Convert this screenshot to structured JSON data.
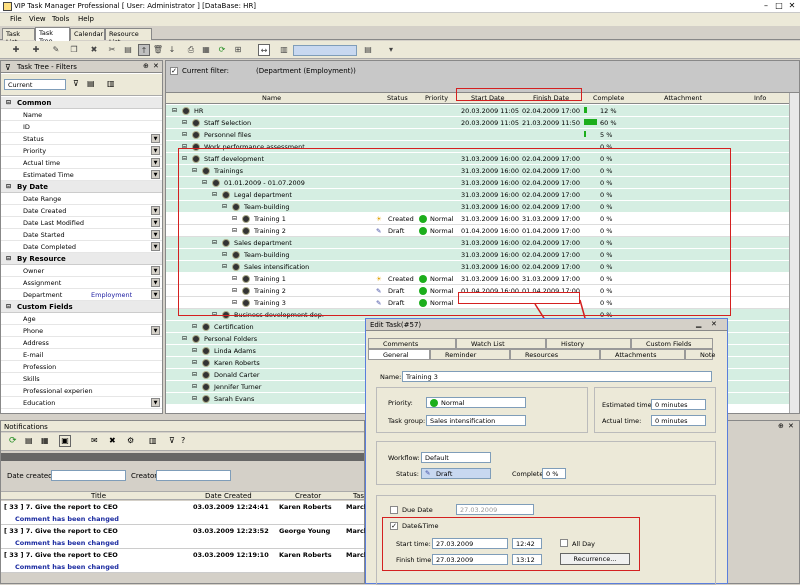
{
  "window": {
    "title": "VIP Task Manager Professional [ User: Administrator ] [DataBase: HR]"
  },
  "menu": [
    "File",
    "View",
    "Tools",
    "Help"
  ],
  "tabs": [
    "Task List",
    "Task Tree",
    "Calendar",
    "Resource List"
  ],
  "left": {
    "title": "Task Tree - Filters",
    "current": "Current",
    "sections": [
      {
        "name": "Common",
        "items": [
          {
            "l": "Name"
          },
          {
            "l": "ID"
          },
          {
            "l": "Status"
          },
          {
            "l": "Priority"
          },
          {
            "l": "Actual time"
          },
          {
            "l": "Estimated Time"
          }
        ]
      },
      {
        "name": "By Date",
        "items": [
          {
            "l": "Date Range"
          },
          {
            "l": "Date Created"
          },
          {
            "l": "Date Last Modified"
          },
          {
            "l": "Date Started"
          },
          {
            "l": "Date Completed"
          }
        ]
      },
      {
        "name": "By Resource",
        "items": [
          {
            "l": "Owner"
          },
          {
            "l": "Assignment"
          },
          {
            "l": "Department",
            "v": "Employment"
          }
        ]
      },
      {
        "name": "Custom Fields",
        "items": [
          {
            "l": "Age"
          },
          {
            "l": "Phone"
          },
          {
            "l": "Address"
          },
          {
            "l": "E-mail"
          },
          {
            "l": "Profession"
          },
          {
            "l": "Skills"
          },
          {
            "l": "Professional experien"
          },
          {
            "l": "Education"
          }
        ]
      }
    ]
  },
  "main": {
    "filter_label": "Current filter:",
    "filter_value": "(Department  (Employment))",
    "columns": [
      "Name",
      "Status",
      "Priority",
      "Start Date",
      "Finish Date",
      "Complete",
      "Attachment",
      "Info"
    ],
    "rows": [
      {
        "name": "HR",
        "indent": 0,
        "start": "20.03.2009 11:05",
        "finish": "02.04.2009 17:00",
        "complete": "12 %",
        "bar": 0.12
      },
      {
        "name": "Staff Selection",
        "indent": 1,
        "start": "20.03.2009 11:05",
        "finish": "21.03.2009 11:50",
        "complete": "60 %",
        "bar": 0.6
      },
      {
        "name": "Personnel files",
        "indent": 1,
        "complete": "5 %",
        "bar": 0.05
      },
      {
        "name": "Work performance assessment",
        "indent": 1,
        "complete": "0 %"
      },
      {
        "name": "Staff development",
        "indent": 1,
        "start": "31.03.2009 16:00",
        "finish": "02.04.2009 17:00",
        "complete": "0 %"
      },
      {
        "name": "Trainings",
        "indent": 2,
        "start": "31.03.2009 16:00",
        "finish": "02.04.2009 17:00",
        "complete": "0 %"
      },
      {
        "name": "01.01.2009 - 01.07.2009",
        "indent": 3,
        "start": "31.03.2009 16:00",
        "finish": "02.04.2009 17:00",
        "complete": "0 %"
      },
      {
        "name": "Legal department",
        "indent": 4,
        "start": "31.03.2009 16:00",
        "finish": "02.04.2009 17:00",
        "complete": "0 %"
      },
      {
        "name": "Team-building",
        "indent": 5,
        "start": "31.03.2009 16:00",
        "finish": "02.04.2009 17:00",
        "complete": "0 %"
      },
      {
        "name": "Training 1",
        "indent": 6,
        "status": "Created",
        "priority": "Normal",
        "start": "31.03.2009 16:00",
        "finish": "31.03.2009 17:00",
        "complete": "0 %",
        "white": true
      },
      {
        "name": "Training 2",
        "indent": 6,
        "status": "Draft",
        "priority": "Normal",
        "start": "01.04.2009 16:00",
        "finish": "01.04.2009 17:00",
        "complete": "0 %",
        "white": true
      },
      {
        "name": "Sales department",
        "indent": 4,
        "start": "31.03.2009 16:00",
        "finish": "02.04.2009 17:00",
        "complete": "0 %"
      },
      {
        "name": "Team-building",
        "indent": 5,
        "start": "31.03.2009 16:00",
        "finish": "02.04.2009 17:00",
        "complete": "0 %"
      },
      {
        "name": "Sales intensification",
        "indent": 5,
        "start": "31.03.2009 16:00",
        "finish": "02.04.2009 17:00",
        "complete": "0 %"
      },
      {
        "name": "Training 1",
        "indent": 6,
        "status": "Created",
        "priority": "Normal",
        "start": "31.03.2009 16:00",
        "finish": "31.03.2009 17:00",
        "complete": "0 %",
        "white": true
      },
      {
        "name": "Training 2",
        "indent": 6,
        "status": "Draft",
        "priority": "Normal",
        "start": "01.04.2009 16:00",
        "finish": "01.04.2009 17:00",
        "complete": "0 %",
        "white": true
      },
      {
        "name": "Training 3",
        "indent": 6,
        "status": "Draft",
        "priority": "Normal",
        "complete": "0 %",
        "white": true
      },
      {
        "name": "Business development dep.",
        "indent": 4,
        "complete": "0 %"
      },
      {
        "name": "Certification",
        "indent": 2,
        "complete": "0 %"
      },
      {
        "name": "Personal Folders",
        "indent": 1,
        "complete": "0 %"
      },
      {
        "name": "Linda  Adams",
        "indent": 2
      },
      {
        "name": "Karen Roberts",
        "indent": 2
      },
      {
        "name": "Donald Carter",
        "indent": 2
      },
      {
        "name": "Jennifer Turner",
        "indent": 2
      },
      {
        "name": "Sarah Evans",
        "indent": 2
      }
    ]
  },
  "notifications": {
    "title": "Notifications",
    "date_created_label": "Date created:",
    "creator_label": "Creator:",
    "columns": [
      "Title",
      "Date Created",
      "Creator",
      "Tas"
    ],
    "rows": [
      {
        "title": "[ 33 ] 7. Give the report to CEO",
        "date": "03.03.2009 12:24:41",
        "creator": "Karen Roberts",
        "task": "March",
        "msg": "Comment has been changed"
      },
      {
        "title": "[ 33 ] 7. Give the report to CEO",
        "date": "03.03.2009 12:23:52",
        "creator": "George Young",
        "task": "March",
        "msg": "Comment has been changed"
      },
      {
        "title": "[ 33 ] 7. Give the report to CEO",
        "date": "03.03.2009 12:19:10",
        "creator": "Karen Roberts",
        "task": "March",
        "msg": "Comment has been changed"
      }
    ]
  },
  "dialog": {
    "title": "Edit Task(#57)",
    "tabs_row1": [
      "Comments",
      "Watch List",
      "History",
      "Custom Fields"
    ],
    "tabs_row2": [
      "General",
      "Reminder",
      "Resources",
      "Attachments",
      "Note"
    ],
    "name_label": "Name:",
    "name_value": "Training 3",
    "priority_label": "Priority:",
    "priority_value": "Normal",
    "taskgroup_label": "Task group:",
    "taskgroup_value": "Sales intensification",
    "est_label": "Estimated time:",
    "est_value": "0 minutes",
    "act_label": "Actual time:",
    "act_value": "0 minutes",
    "workflow_label": "Workflow:",
    "workflow_value": "Default",
    "status_label": "Status:",
    "status_value": "Draft",
    "complete_label": "Complete:",
    "complete_value": "0 %",
    "duedate_label": "Due Date",
    "duedate_value": "27.03.2009",
    "datetime_label": "Date&Time",
    "start_label": "Start time:",
    "start_date": "27.03.2009",
    "start_time": "12:42",
    "allday_label": "All Day",
    "finish_label": "Finish time:",
    "finish_date": "27.03.2009",
    "finish_time": "13:12",
    "recurrence_label": "Recurrence..."
  }
}
